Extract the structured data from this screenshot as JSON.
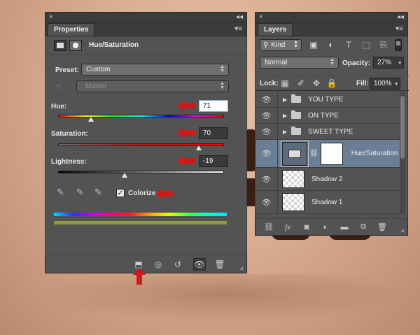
{
  "properties_panel": {
    "close_glyph": "×",
    "collapse_glyph": "◂◂",
    "tab_label": "Properties",
    "menu_glyph": "▾≡",
    "adjustment_title": "Hue/Saturation",
    "preset_label": "Preset:",
    "preset_value": "Custom",
    "channel_value": "Master",
    "hue": {
      "label": "Hue:",
      "value": "71",
      "fraction": 0.2
    },
    "saturation": {
      "label": "Saturation:",
      "value": "70",
      "fraction": 0.85
    },
    "lightness": {
      "label": "Lightness:",
      "value": "-19",
      "fraction": 0.4
    },
    "colorize_label": "Colorize",
    "colorize_checked": true
  },
  "layers_panel": {
    "close_glyph": "×",
    "collapse_glyph": "◂◂",
    "tab_label": "Layers",
    "menu_glyph": "▾≡",
    "kind_label": "Kind",
    "blend_mode": "Normal",
    "opacity_label": "Opacity:",
    "opacity_value": "27%",
    "lock_label": "Lock:",
    "fill_label": "Fill:",
    "fill_value": "100%",
    "layers": [
      {
        "name": "YOU TYPE",
        "type": "group"
      },
      {
        "name": "ON TYPE",
        "type": "group"
      },
      {
        "name": "SWEET TYPE",
        "type": "group"
      },
      {
        "name": "Hue/Saturation",
        "type": "adjustment",
        "selected": true
      },
      {
        "name": "Shadow 2",
        "type": "pixel"
      },
      {
        "name": "Shadow 1",
        "type": "pixel"
      }
    ]
  },
  "colors": {
    "panel_bg": "#535353",
    "selected_layer": "#6a7e96",
    "annotation_red": "#d0191b"
  }
}
